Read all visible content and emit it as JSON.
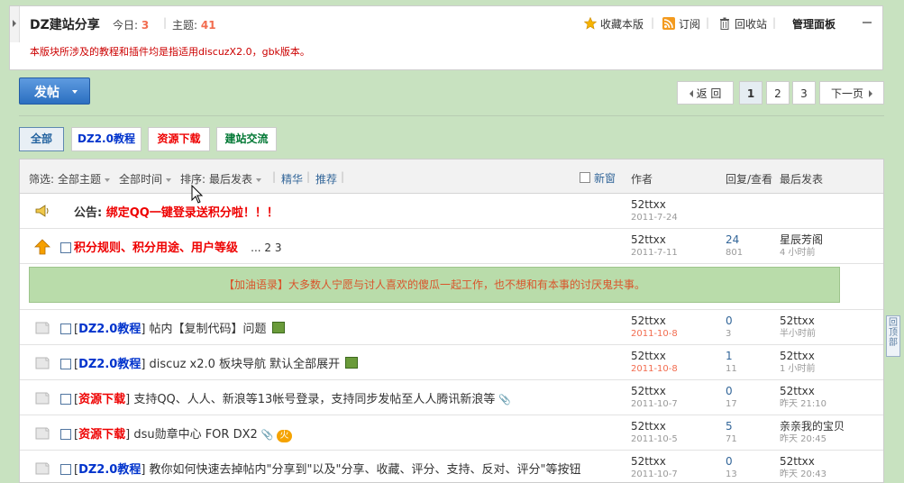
{
  "forum": {
    "title": "DZ建站分享",
    "today_label": "今日:",
    "today_count": "3",
    "threads_label": "主题:",
    "threads_count": "41",
    "notice": "本版块所涉及的教程和插件均是指适用discuzX2.0，gbk版本。",
    "links": {
      "favorite": "收藏本版",
      "rss": "订阅",
      "trash": "回收站",
      "admin": "管理面板"
    }
  },
  "toolbar": {
    "post_label": "发帖"
  },
  "pager": {
    "prev": "返 回",
    "pages": [
      "1",
      "2",
      "3"
    ],
    "current": "1",
    "next": "下一页"
  },
  "type_tabs": [
    "全部",
    "DZ2.0教程",
    "资源下载",
    "建站交流"
  ],
  "filter": {
    "label": "筛选:",
    "all_threads": "全部主题",
    "all_time": "全部时间",
    "sort_label": "排序:",
    "sort_value": "最后发表",
    "digest": "精华",
    "recommend": "推荐",
    "new_window": "新窗"
  },
  "columns": {
    "author": "作者",
    "replies_views": "回复/查看",
    "last_post": "最后发表"
  },
  "announcement": {
    "prefix": "公告:",
    "title": "绑定QQ一键登录送积分啦！！！",
    "author": "52ttxx",
    "date": "2011-7-24"
  },
  "sticky": {
    "title": "积分规则、积分用途、用户等级",
    "page_links": "... 2  3",
    "author": "52ttxx",
    "date": "2011-7-11",
    "replies": "24",
    "views": "801",
    "last_user": "星辰芳阁",
    "last_time": "4 小时前"
  },
  "ad_text": "【加油语录】大多数人宁愿与讨人喜欢的傻瓜一起工作，也不想和有本事的讨厌鬼共事。",
  "threads": [
    {
      "category": "DZ2.0教程",
      "title": "帖内【复制代码】问题",
      "author": "52ttxx",
      "date": "2011-10-8",
      "replies": "0",
      "views": "3",
      "last_user": "52ttxx",
      "last_time": "半小时前"
    },
    {
      "category": "DZ2.0教程",
      "title": "discuz x2.0 板块导航 默认全部展开",
      "author": "52ttxx",
      "date": "2011-10-8",
      "replies": "1",
      "views": "11",
      "last_user": "52ttxx",
      "last_time": "1 小时前"
    },
    {
      "category": "资源下载",
      "title": "支持QQ、人人、新浪等13帐号登录，支持同步发帖至人人腾讯新浪等",
      "author": "52ttxx",
      "date": "2011-10-7",
      "replies": "0",
      "views": "17",
      "last_user": "52ttxx",
      "last_time": "昨天 21:10"
    },
    {
      "category": "资源下载",
      "title": "dsu勋章中心 FOR DX2",
      "author": "52ttxx",
      "date": "2011-10-5",
      "replies": "5",
      "views": "71",
      "last_user": "亲亲我的宝贝",
      "last_time": "昨天 20:45"
    },
    {
      "category": "DZ2.0教程",
      "title": "教你如何快速去掉帖内\"分享到\"以及\"分享、收藏、评分、支持、反对、评分\"等按钮",
      "author": "52ttxx",
      "date": "2011-10-7",
      "replies": "0",
      "views": "13",
      "last_user": "52ttxx",
      "last_time": "昨天 20:43"
    }
  ],
  "fire_label": "火",
  "to_top": {
    "line1": "回",
    "line2": "顶部"
  },
  "colors": {
    "background": "#c8e2c0",
    "accent_blue": "#2b6fc0",
    "red": "#e00000",
    "link": "#336699"
  }
}
